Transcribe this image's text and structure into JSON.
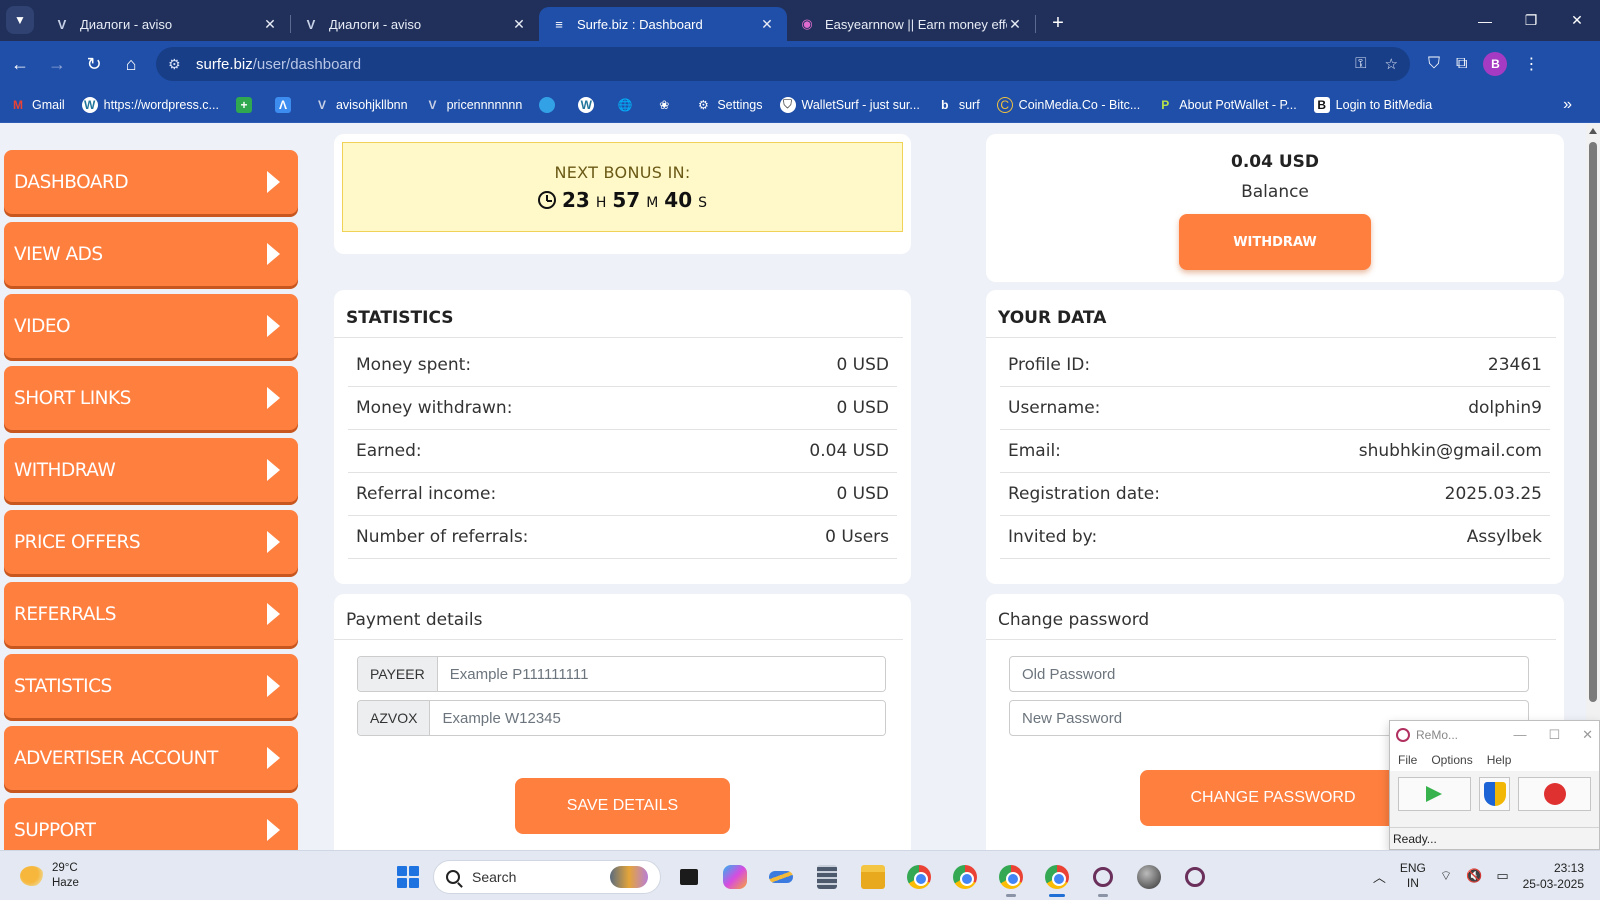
{
  "browser": {
    "tabs": [
      {
        "title": "Диалоги - aviso",
        "icon": "aviso-icon",
        "active": false
      },
      {
        "title": "Диалоги - aviso",
        "icon": "aviso-icon",
        "active": false
      },
      {
        "title": "Surfe.biz : Dashboard",
        "icon": "surfe-icon",
        "active": true
      },
      {
        "title": "Easyearnnow || Earn money effo",
        "icon": "easyearn-icon",
        "active": false
      }
    ],
    "address": {
      "domain": "surfe.biz",
      "path": "/user/dashboard"
    },
    "profile_initial": "B",
    "bookmarks": [
      {
        "label": "Gmail",
        "icon": "gmail-icon"
      },
      {
        "label": "https://wordpress.c...",
        "icon": "wordpress-icon"
      },
      {
        "label": "",
        "icon": "green-plus-icon"
      },
      {
        "label": "",
        "icon": "blue-a-icon"
      },
      {
        "label": "avisohjkllbnn",
        "icon": "aviso-icon"
      },
      {
        "label": "pricennnnnnn",
        "icon": "aviso-icon"
      },
      {
        "label": "",
        "icon": "circle-blue-icon"
      },
      {
        "label": "",
        "icon": "wordpress-icon"
      },
      {
        "label": "",
        "icon": "globe-icon"
      },
      {
        "label": "",
        "icon": "tree-icon"
      },
      {
        "label": "Settings",
        "icon": "gear-icon"
      },
      {
        "label": "WalletSurf - just sur...",
        "icon": "shield-icon"
      },
      {
        "label": "surf",
        "icon": "b-letter-icon"
      },
      {
        "label": "CoinMedia.Co - Bitc...",
        "icon": "coinmedia-icon"
      },
      {
        "label": "About PotWallet - P...",
        "icon": "potwallet-icon"
      },
      {
        "label": "Login to BitMedia",
        "icon": "bitmedia-icon"
      }
    ]
  },
  "sidebar": {
    "items": [
      {
        "label": "DASHBOARD",
        "key": "dashboard"
      },
      {
        "label": "VIEW ADS",
        "key": "view-ads"
      },
      {
        "label": "VIDEO",
        "key": "video"
      },
      {
        "label": "SHORT LINKS",
        "key": "short-links"
      },
      {
        "label": "WITHDRAW",
        "key": "withdraw"
      },
      {
        "label": "PRICE OFFERS",
        "key": "price-offers"
      },
      {
        "label": "REFERRALS",
        "key": "referrals"
      },
      {
        "label": "STATISTICS",
        "key": "statistics"
      },
      {
        "label": "ADVERTISER ACCOUNT",
        "key": "advertiser-account"
      },
      {
        "label": "SUPPORT",
        "key": "support"
      }
    ]
  },
  "bonus": {
    "title": "NEXT BONUS IN:",
    "hours": "23",
    "hours_unit": "H",
    "minutes": "57",
    "minutes_unit": "M",
    "seconds": "40",
    "seconds_unit": "S"
  },
  "balance": {
    "amount": "0.04 USD",
    "label": "Balance",
    "withdraw_label": "WITHDRAW"
  },
  "statistics": {
    "title": "STATISTICS",
    "rows": [
      {
        "label": "Money spent:",
        "value": "0 USD"
      },
      {
        "label": "Money withdrawn:",
        "value": "0 USD"
      },
      {
        "label": "Earned:",
        "value": "0.04 USD"
      },
      {
        "label": "Referral income:",
        "value": "0 USD"
      },
      {
        "label": "Number of referrals:",
        "value": "0 Users"
      }
    ]
  },
  "your_data": {
    "title": "YOUR DATA",
    "rows": [
      {
        "label": "Profile ID:",
        "value": "23461"
      },
      {
        "label": "Username:",
        "value": "dolphin9"
      },
      {
        "label": "Email:",
        "value": "shubhkin@gmail.com"
      },
      {
        "label": "Registration date:",
        "value": "2025.03.25"
      },
      {
        "label": "Invited by:",
        "value": "Assylbek"
      }
    ]
  },
  "payment": {
    "title": "Payment details",
    "fields": [
      {
        "addon": "PAYEER",
        "placeholder": "Example P111111111",
        "value": ""
      },
      {
        "addon": "AZVOX",
        "placeholder": "Example W12345",
        "value": ""
      }
    ],
    "save_label": "SAVE DETAILS"
  },
  "password": {
    "title": "Change password",
    "old_placeholder": "Old Password",
    "new_placeholder": "New Password",
    "button_label": "CHANGE PASSWORD"
  },
  "recorder": {
    "title": "ReMo...",
    "menu": [
      "File",
      "Options",
      "Help"
    ],
    "status": "Ready..."
  },
  "taskbar": {
    "weather_temp": "29°C",
    "weather_desc": "Haze",
    "search_placeholder": "Search",
    "lang_line1": "ENG",
    "lang_line2": "IN",
    "time": "23:13",
    "date": "25-03-2025"
  },
  "colors": {
    "accent": "#ff7f3f",
    "browser_frame": "#1f4fa8",
    "bonus_bg": "#fff8c9"
  }
}
